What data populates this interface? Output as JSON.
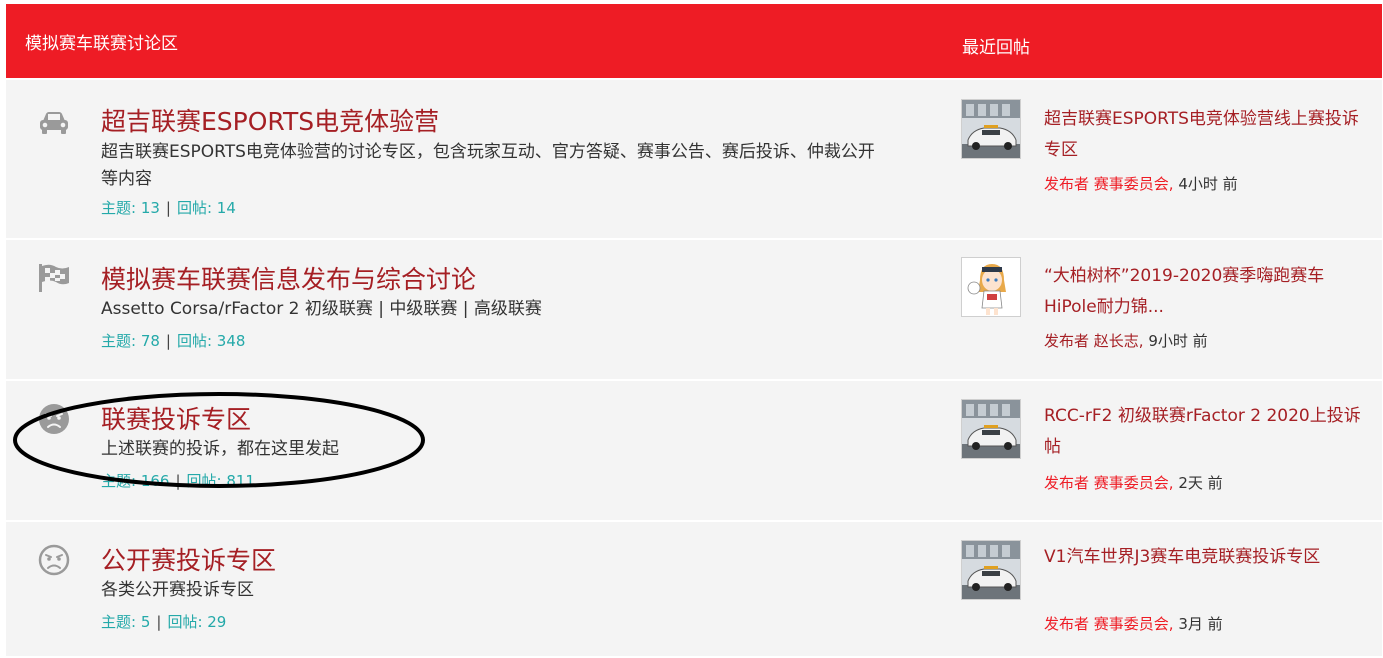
{
  "header": {
    "title": "模拟赛车联赛讨论区",
    "latest_label": "最近回帖",
    "color": "#ee1c25"
  },
  "forums": [
    {
      "icon": "car-icon",
      "title": "超吉联赛ESPORTS电竞体验营",
      "description": "超吉联赛ESPORTS电竞体验营的讨论专区，包含玩家互动、官方答疑、赛事公告、赛后投诉、仲裁公开等内容",
      "topics_label": "主题: 13",
      "replies_label": "回帖: 14",
      "stats_sep": "|",
      "latest": {
        "thumb": "safety-car-thumbnail",
        "title": "超吉联赛ESPORTS电竞体验营线上赛投诉专区",
        "by": "发布者",
        "author": "赛事委员会,",
        "time": "4小时 前"
      }
    },
    {
      "icon": "checkered-flag-icon",
      "title": "模拟赛车联赛信息发布与综合讨论",
      "description": "Assetto Corsa/rFactor 2 初级联赛 | 中级联赛 | 高级联赛",
      "topics_label": "主题: 78",
      "replies_label": "回帖: 348",
      "stats_sep": "|",
      "latest": {
        "thumb": "anime-girl-avatar",
        "title": "“大柏树杯”2019-2020赛季嗨跑赛车HiPole耐力锦...",
        "by": "发布者",
        "author": "赵长志,",
        "time": "9小时 前"
      }
    },
    {
      "icon": "angry-face-solid-icon",
      "title": "联赛投诉专区",
      "description": "上述联赛的投诉，都在这里发起",
      "topics_label": "主题: 166",
      "replies_label": "回帖: 811",
      "stats_sep": "|",
      "latest": {
        "thumb": "safety-car-thumbnail",
        "title": "RCC-rF2 初级联赛rFactor 2 2020上投诉帖",
        "by": "发布者",
        "author": "赛事委员会,",
        "time": "2天 前"
      }
    },
    {
      "icon": "angry-face-outline-icon",
      "title": "公开赛投诉专区",
      "description": "各类公开赛投诉专区",
      "topics_label": "主题: 5",
      "replies_label": "回帖: 29",
      "stats_sep": "|",
      "latest": {
        "thumb": "safety-car-thumbnail",
        "title": "V1汽车世界J3赛车电竞联赛投诉专区",
        "by": "发布者",
        "author": "赛事委员会,",
        "time": "3月 前"
      }
    }
  ]
}
